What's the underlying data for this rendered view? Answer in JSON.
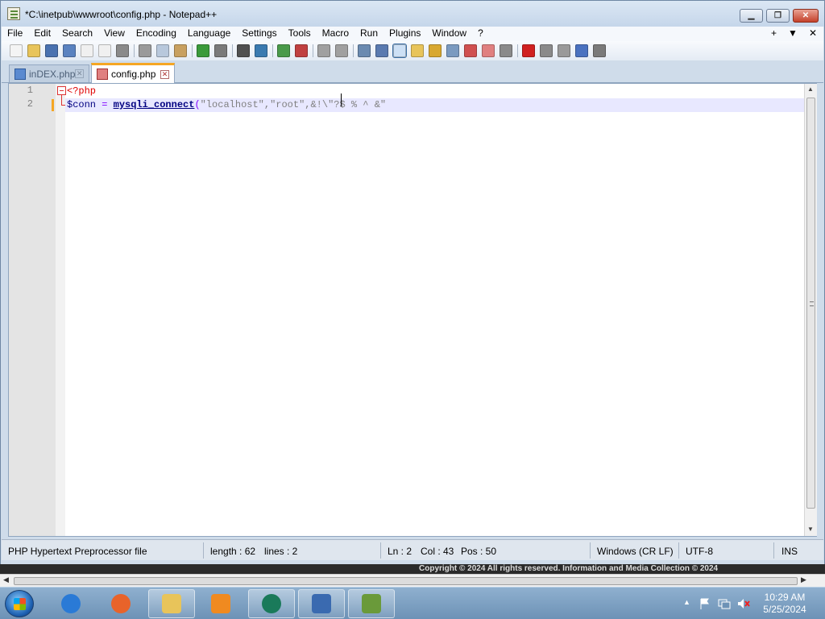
{
  "window": {
    "title": "*C:\\inetpub\\wwwroot\\config.php - Notepad++",
    "minimize_label": "▁",
    "maximize_label": "❐",
    "close_label": "✕"
  },
  "menubar": {
    "items": [
      "File",
      "Edit",
      "Search",
      "View",
      "Encoding",
      "Language",
      "Settings",
      "Tools",
      "Macro",
      "Run",
      "Plugins",
      "Window",
      "?"
    ],
    "right": [
      "+",
      "▼",
      "✕"
    ]
  },
  "toolbar": {
    "buttons": [
      {
        "icon": "new-file-icon",
        "color": "#f4f4f4"
      },
      {
        "icon": "open-folder-icon",
        "color": "#e8c45a"
      },
      {
        "icon": "save-icon",
        "color": "#4a72b0"
      },
      {
        "icon": "save-all-icon",
        "color": "#5a82c0"
      },
      {
        "icon": "close-file-icon",
        "color": "#f0f0f0"
      },
      {
        "icon": "close-all-icon",
        "color": "#f0f0f0"
      },
      {
        "icon": "print-icon",
        "color": "#8a8a8a"
      },
      {
        "sep": true
      },
      {
        "icon": "cut-icon",
        "color": "#9a9a9a"
      },
      {
        "icon": "copy-icon",
        "color": "#b8c8dc"
      },
      {
        "icon": "paste-icon",
        "color": "#c8a060"
      },
      {
        "sep": true
      },
      {
        "icon": "undo-icon",
        "color": "#3a9a3a"
      },
      {
        "icon": "redo-icon",
        "color": "#7a7a7a"
      },
      {
        "sep": true
      },
      {
        "icon": "find-icon",
        "color": "#505050"
      },
      {
        "icon": "replace-icon",
        "color": "#3a7ab0"
      },
      {
        "sep": true
      },
      {
        "icon": "zoom-in-icon",
        "color": "#4a9a4a"
      },
      {
        "icon": "zoom-out-icon",
        "color": "#c04040"
      },
      {
        "sep": true
      },
      {
        "icon": "sync-vertical-icon",
        "color": "#a0a0a0"
      },
      {
        "icon": "sync-horizontal-icon",
        "color": "#a0a0a0"
      },
      {
        "sep": true
      },
      {
        "icon": "word-wrap-icon",
        "color": "#6a8ab0"
      },
      {
        "icon": "show-all-chars-icon",
        "color": "#5a7ab0"
      },
      {
        "icon": "indent-guide-icon",
        "color": "#3a6ea5",
        "active": true
      },
      {
        "icon": "user-defined-lang-icon",
        "color": "#e8c45a"
      },
      {
        "icon": "doc-map-icon",
        "color": "#d8a830"
      },
      {
        "icon": "function-list-icon",
        "color": "#7a9ac0"
      },
      {
        "icon": "folder-as-workspace-icon",
        "color": "#d05050"
      },
      {
        "icon": "clipboard-history-icon",
        "color": "#e08080"
      },
      {
        "icon": "monitoring-icon",
        "color": "#8a8a8a"
      },
      {
        "sep": true
      },
      {
        "icon": "record-macro-icon",
        "color": "#d02020"
      },
      {
        "icon": "stop-record-icon",
        "color": "#8a8a8a"
      },
      {
        "icon": "playback-macro-icon",
        "color": "#9a9a9a"
      },
      {
        "icon": "run-macro-multiple-icon",
        "color": "#4a72c0"
      },
      {
        "icon": "save-macro-icon",
        "color": "#7a7a7a"
      }
    ]
  },
  "tabs": [
    {
      "label": "inDEX.php",
      "active": false
    },
    {
      "label": "config.php",
      "active": true
    }
  ],
  "editor": {
    "line_numbers": [
      "1",
      "2"
    ],
    "line1": {
      "php_open": "<?php"
    },
    "line2": {
      "var": "$conn",
      "assign": " = ",
      "fn": "mysqli_connect",
      "paren": "(",
      "args": "\"localhost\",\"root\",",
      "tail": "&!\\\"?$ % ^ &\""
    }
  },
  "statusbar": {
    "file_type": "PHP Hypertext Preprocessor file",
    "length": "length : 62",
    "lines": "lines : 2",
    "ln": "Ln : 2",
    "col": "Col : 43",
    "pos": "Pos : 50",
    "eol": "Windows (CR LF)",
    "encoding": "UTF-8",
    "mode": "INS"
  },
  "bottom_strip": {
    "text": "Copyright © 2024 All rights reserved. Information and Media Collection © 2024"
  },
  "taskbar": {
    "apps": [
      {
        "name": "internet-explorer-icon",
        "color": "#2a7ad6",
        "pinned": false
      },
      {
        "name": "firefox-icon",
        "color": "#e8632a",
        "pinned": false
      },
      {
        "name": "file-explorer-icon",
        "color": "#e8c45a",
        "pinned": true
      },
      {
        "name": "media-player-icon",
        "color": "#f08a20",
        "pinned": false
      },
      {
        "name": "teamviewer-icon",
        "color": "#1a7a5a",
        "pinned": true
      },
      {
        "name": "windows-update-icon",
        "color": "#3a6ab0",
        "pinned": true
      },
      {
        "name": "notepadpp-icon",
        "color": "#6a9a3a",
        "pinned": true
      }
    ],
    "clock_time": "10:29 AM",
    "clock_date": "5/25/2024"
  }
}
